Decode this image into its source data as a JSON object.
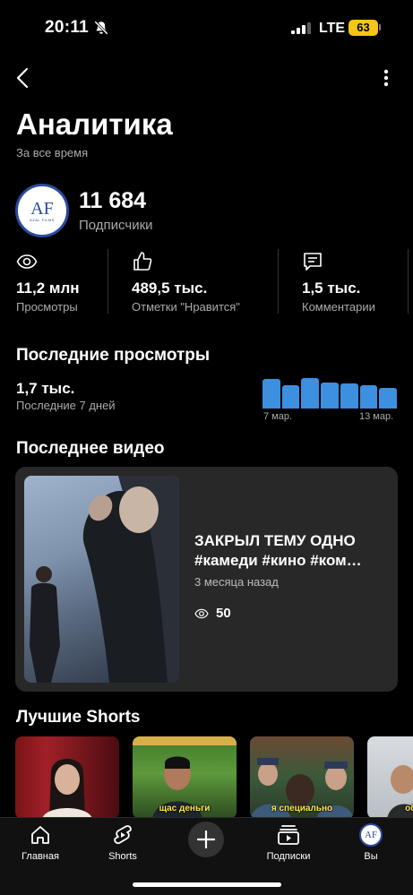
{
  "status_bar": {
    "time": "20:11",
    "network": "LTE",
    "battery": "63"
  },
  "header": {
    "title": "Аналитика",
    "subtitle": "За все время"
  },
  "channel": {
    "avatar_text": "AF",
    "avatar_subtext": "AZAL FILMS",
    "subscribers": "11 684",
    "subscribers_label": "Подписчики"
  },
  "stats": [
    {
      "icon": "eye-icon",
      "value": "11,2 млн",
      "label": "Просмотры"
    },
    {
      "icon": "thumbs-up-icon",
      "value": "489,5 тыс.",
      "label": "Отметки \"Нравится\""
    },
    {
      "icon": "comment-icon",
      "value": "1,5 тыс.",
      "label": "Комментарии"
    }
  ],
  "recent_views": {
    "title": "Последние просмотры",
    "value": "1,7 тыс.",
    "label": "Последние 7 дней",
    "axis_start": "7 мар.",
    "axis_end": "13 мар.",
    "bar_color": "#3d8fe0",
    "bar_levels": [
      0.92,
      0.72,
      0.94,
      0.8,
      0.78,
      0.72,
      0.64
    ]
  },
  "latest_video": {
    "title": "Последнее видео",
    "video_title_line1": "ЗАКРЫЛ ТЕМУ ОДНО",
    "video_title_line2": "#камеди #кино #ком…",
    "age": "3 месяца назад",
    "views": "50"
  },
  "shorts": {
    "title": "Лучшие Shorts",
    "captions": [
      "",
      "щас деньги",
      "я специально",
      "обе"
    ]
  },
  "tab_bar": [
    {
      "label": "Главная",
      "icon": "home-icon"
    },
    {
      "label": "Shorts",
      "icon": "shorts-icon"
    },
    {
      "label": "",
      "icon": "plus-icon"
    },
    {
      "label": "Подписки",
      "icon": "subscriptions-icon"
    },
    {
      "label": "Вы",
      "icon": "avatar"
    }
  ]
}
